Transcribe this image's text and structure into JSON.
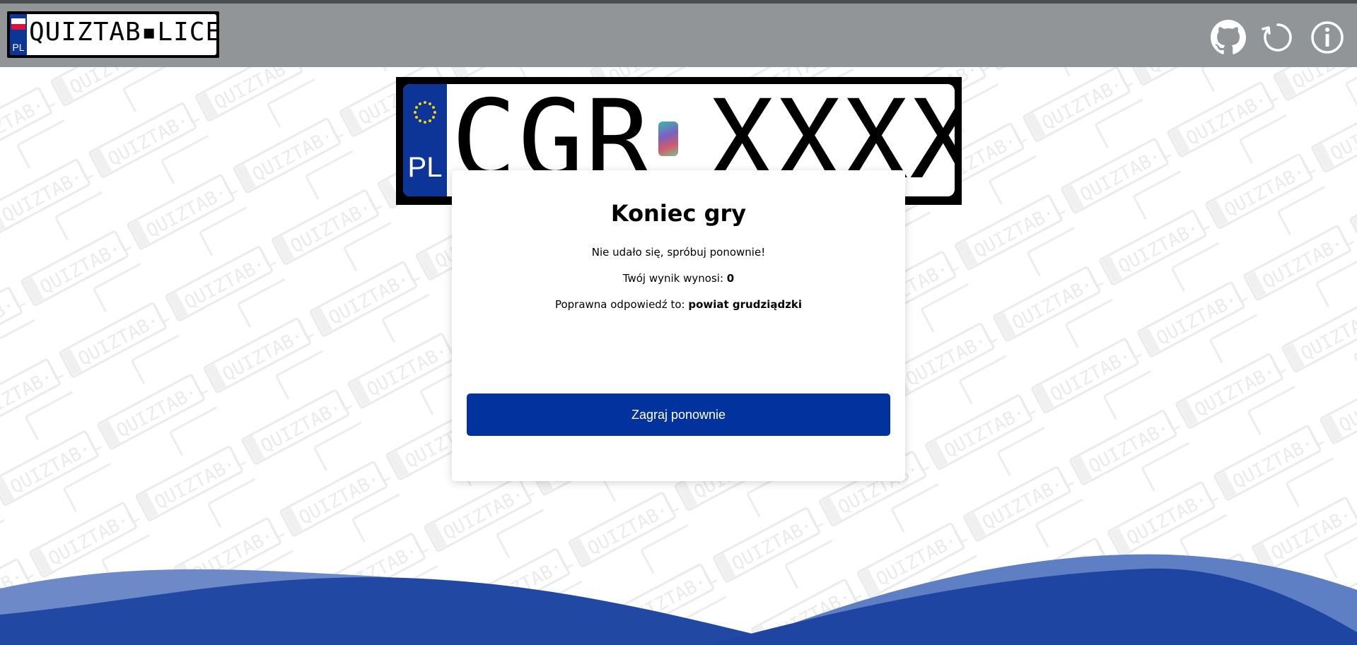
{
  "header": {
    "logo": {
      "country_code": "PL",
      "text": "QUIZTAB▪LICE"
    },
    "icons": [
      {
        "name": "github-icon"
      },
      {
        "name": "refresh-icon"
      },
      {
        "name": "info-icon"
      }
    ]
  },
  "plate": {
    "country_code": "PL",
    "prefix": "CGR",
    "suffix": "XXXX"
  },
  "modal": {
    "title": "Koniec gry",
    "message": "Nie udało się, spróbuj ponownie!",
    "score_label": "Twój wynik wynosi: ",
    "score_value": "0",
    "answer_label": "Poprawna odpowiedź to: ",
    "answer_value": "powiat grudziądzki",
    "play_again_label": "Zagraj ponownie"
  },
  "colors": {
    "topbar": "#929598",
    "plate_blue": "#0d3597",
    "button": "#02329e",
    "wave_dark": "#1f45a2",
    "wave_light": "#5f7fc4"
  }
}
